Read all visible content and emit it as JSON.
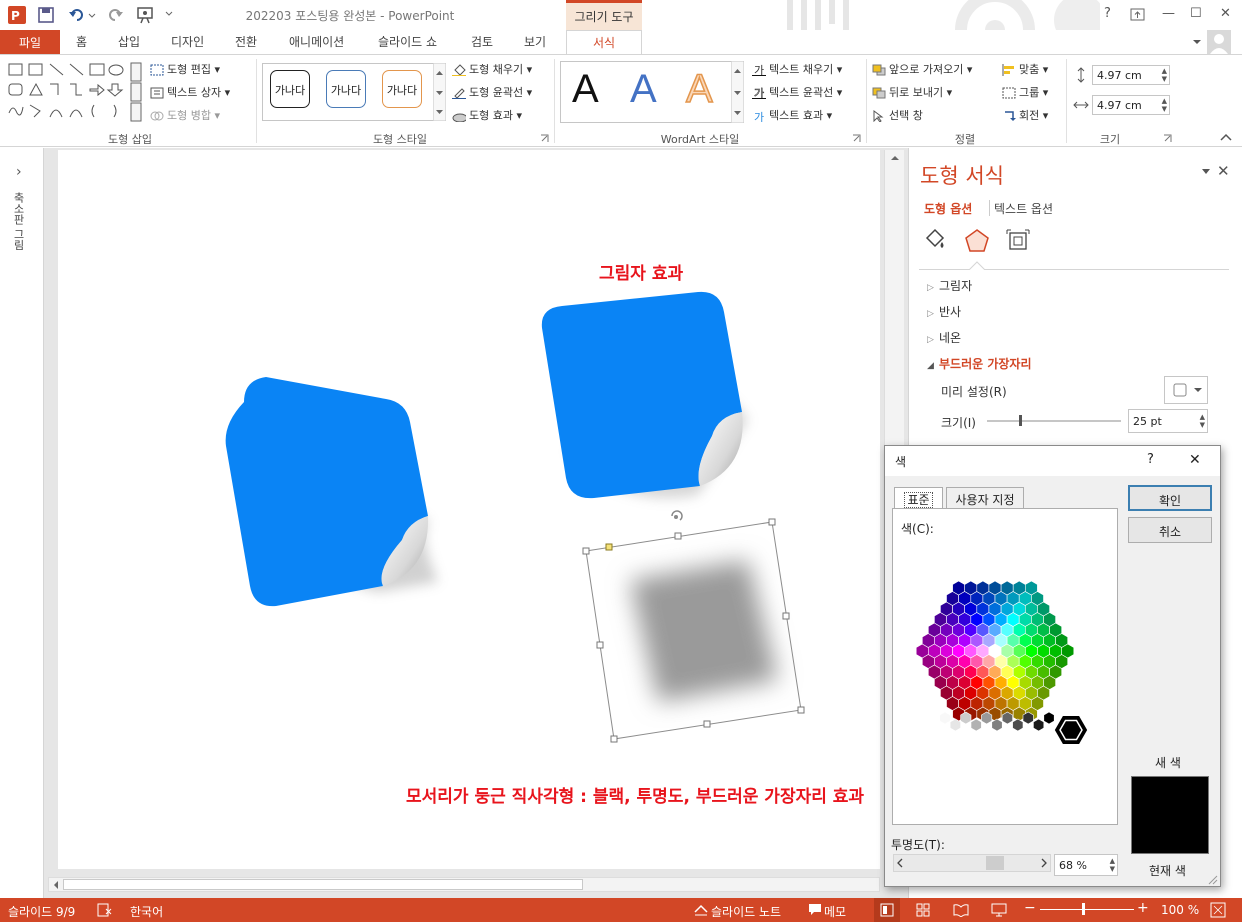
{
  "window": {
    "title": "202203 포스팅용 완성본 - PowerPoint",
    "context_tab": "그리기 도구",
    "help": "?",
    "minimize": "—",
    "restore": "☐",
    "close": "✕"
  },
  "tabs": [
    "파일",
    "홈",
    "삽입",
    "디자인",
    "전환",
    "애니메이션",
    "슬라이드 쇼",
    "검토",
    "보기",
    "서식"
  ],
  "ribbon": {
    "insert_shapes": {
      "label": "도형 삽입",
      "edit_shape": "도형 편집",
      "text_box": "텍스트 상자",
      "merge_shapes": "도형 병합"
    },
    "shape_styles": {
      "label": "도형 스타일",
      "samples": [
        "가나다",
        "가나다",
        "가나다"
      ],
      "fill": "도형 채우기",
      "outline": "도형 윤곽선",
      "effects": "도형 효과"
    },
    "wordart": {
      "label": "WordArt 스타일",
      "samples": [
        "A",
        "A",
        "A"
      ],
      "text_fill": "텍스트 채우기",
      "text_outline": "텍스트 윤곽선",
      "text_effects": "텍스트 효과"
    },
    "arrange": {
      "label": "정렬",
      "bring_forward": "앞으로 가져오기",
      "send_backward": "뒤로 보내기",
      "selection_pane": "선택 창",
      "align": "맞춤",
      "group": "그룹",
      "rotate": "회전"
    },
    "size": {
      "label": "크기",
      "height": "4.97 cm",
      "width": "4.97 cm"
    }
  },
  "left_panel": {
    "label": "축소판 그림",
    "expand": "›"
  },
  "slide": {
    "label_shadow": "그림자 효과",
    "label_caption": "모서리가 둥근 직사각형 : 블랙, 투명도, 부드러운 가장자리 효과",
    "shape_color": "#0a84f5"
  },
  "format_pane": {
    "title": "도형 서식",
    "tab_shape": "도형 옵션",
    "tab_text": "텍스트 옵션",
    "sections": [
      "그림자",
      "반사",
      "네온",
      "부드러운 가장자리"
    ],
    "preset_label": "미리 설정(R)",
    "size_label": "크기(I)",
    "size_value": "25 pt",
    "accent": "#d24726"
  },
  "color_dialog": {
    "title": "색",
    "help": "?",
    "close": "✕",
    "tab_standard": "표준",
    "tab_custom": "사용자 지정",
    "colors_label": "색(C):",
    "ok": "확인",
    "cancel": "취소",
    "new_label": "새 색",
    "current_label": "현재 색",
    "transparency_label": "투명도(T):",
    "transparency_value": "68 %",
    "selected_color": "#000000"
  },
  "status": {
    "slide": "슬라이드 9/9",
    "language": "한국어",
    "notes": "슬라이드 노트",
    "comments": "메모",
    "zoom": "100 %"
  }
}
